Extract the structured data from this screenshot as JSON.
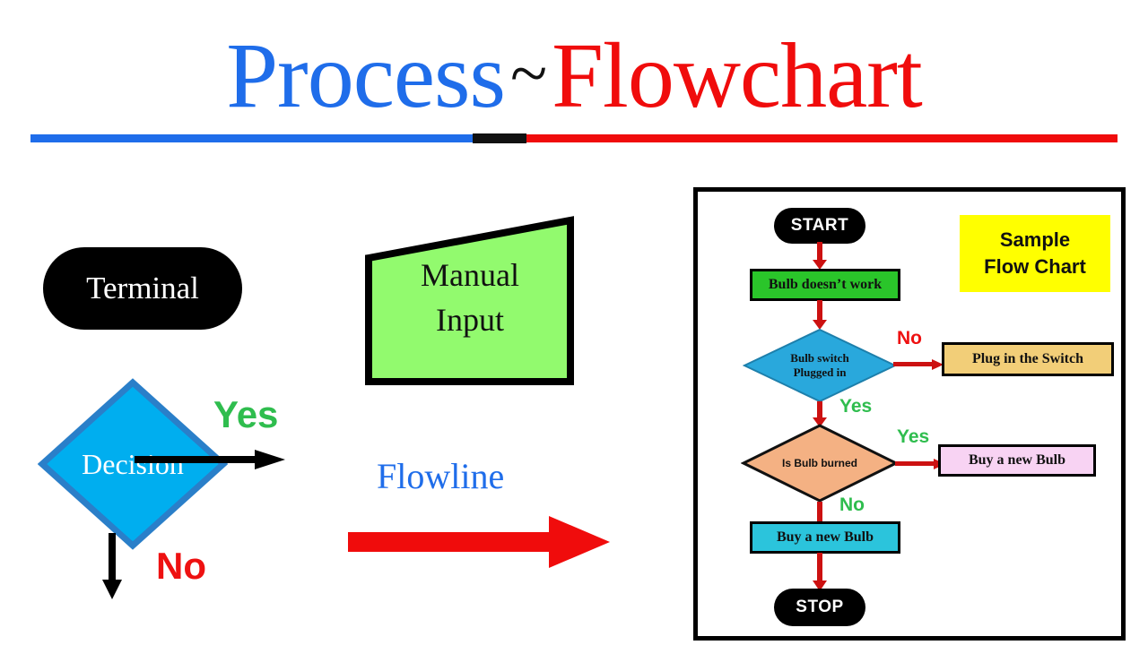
{
  "title": {
    "word_blue": "Process",
    "separator": "~",
    "word_red": "Flowchart",
    "color_blue": "#1f6dea",
    "color_black": "#111111",
    "color_red": "#f00c0c"
  },
  "legend": {
    "terminal": {
      "label": "Terminal",
      "fill": "#000000",
      "text_color": "#ffffff"
    },
    "decision": {
      "label": "Decision",
      "fill": "#00aeef",
      "stroke": "#2a7fc9",
      "text_color": "#ffffff"
    },
    "decision_yes": {
      "label": "Yes",
      "color": "#2fbd4e"
    },
    "decision_no": {
      "label": "No",
      "color": "#ee1111"
    },
    "manual_input": {
      "label_line1": "Manual",
      "label_line2": "Input",
      "fill": "#92fa6e",
      "stroke": "#000000"
    },
    "flowline": {
      "label": "Flowline",
      "label_color": "#1f6dea",
      "arrow_color": "#f00c0c"
    }
  },
  "flowchart": {
    "panel_border_color": "#000000",
    "arrow_color": "#cc1111",
    "caption": {
      "line1": "Sample",
      "line2": "Flow Chart",
      "fill": "#ffff00",
      "text_color": "#111111"
    },
    "nodes": [
      {
        "id": "start",
        "label": "START",
        "shape": "terminal",
        "fill": "#000000",
        "text_color": "#ffffff"
      },
      {
        "id": "problem",
        "label": "Bulb doesn’t work",
        "shape": "process",
        "fill": "#2ac52a",
        "text_color": "#111111"
      },
      {
        "id": "switch_check",
        "label_line1": "Bulb switch",
        "label_line2": "Plugged in",
        "shape": "decision",
        "fill": "#29a8dc",
        "text_color": "#111111"
      },
      {
        "id": "plug_switch",
        "label": "Plug in the Switch",
        "shape": "process",
        "fill": "#f2ce78",
        "text_color": "#111111"
      },
      {
        "id": "burned_check",
        "label": "Is Bulb burned",
        "shape": "decision",
        "fill": "#f4b183",
        "text_color": "#111111"
      },
      {
        "id": "buy_bulb_yes",
        "label": "Buy a new Bulb",
        "shape": "process",
        "fill": "#f8d3f3",
        "text_color": "#111111"
      },
      {
        "id": "buy_bulb_no",
        "label": "Buy a new Bulb",
        "shape": "process",
        "fill": "#2bc4dc",
        "text_color": "#111111"
      },
      {
        "id": "stop",
        "label": "STOP",
        "shape": "terminal",
        "fill": "#000000",
        "text_color": "#ffffff"
      }
    ],
    "edge_labels": {
      "switch_no": "No",
      "switch_yes": "Yes",
      "burned_yes": "Yes",
      "burned_no": "No"
    }
  }
}
